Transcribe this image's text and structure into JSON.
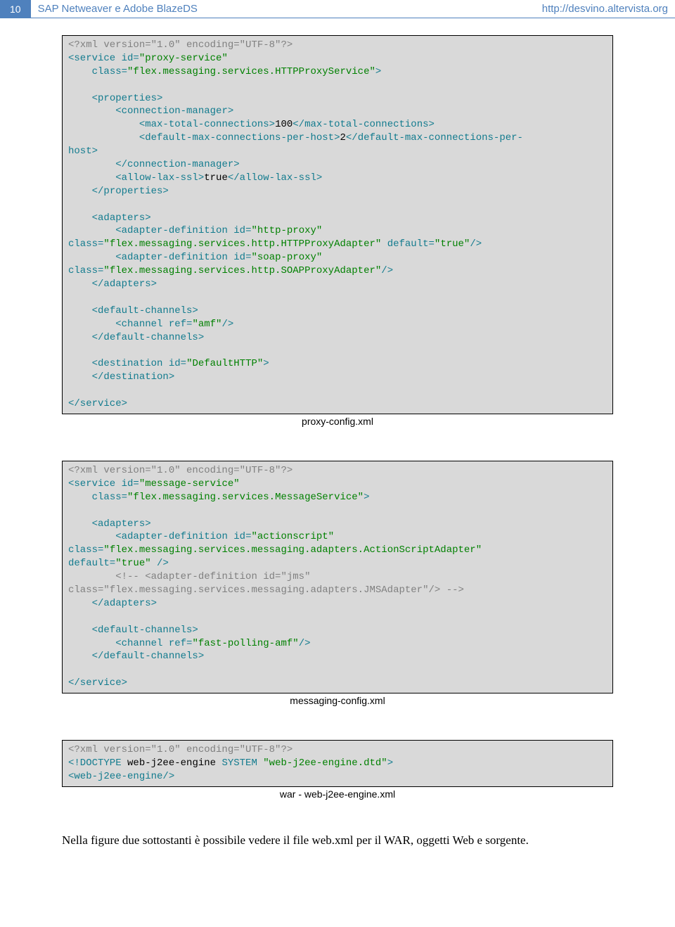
{
  "header": {
    "page_number": "10",
    "title": "SAP Netweaver e Adobe BlazeDS",
    "url": "http://desvino.altervista.org"
  },
  "code_block_1": {
    "caption": "proxy-config.xml",
    "lines": [
      [
        [
          "cmt",
          "<?xml version=\"1.0\" encoding=\"UTF-8\"?>"
        ]
      ],
      [
        [
          "kw",
          "<service"
        ],
        [
          "txtv",
          " "
        ],
        [
          "attr",
          "id="
        ],
        [
          "str",
          "\"proxy-service\""
        ]
      ],
      [
        [
          "txtv",
          "    "
        ],
        [
          "attr",
          "class="
        ],
        [
          "str",
          "\"flex.messaging.services.HTTPProxyService\""
        ],
        [
          "kw",
          ">"
        ]
      ],
      [
        [
          "txtv",
          ""
        ]
      ],
      [
        [
          "txtv",
          "    "
        ],
        [
          "kw",
          "<properties>"
        ]
      ],
      [
        [
          "txtv",
          "        "
        ],
        [
          "kw",
          "<connection-manager>"
        ]
      ],
      [
        [
          "txtv",
          "            "
        ],
        [
          "kw",
          "<max-total-connections>"
        ],
        [
          "txtv",
          "100"
        ],
        [
          "kw",
          "</max-total-connections>"
        ]
      ],
      [
        [
          "txtv",
          "            "
        ],
        [
          "kw",
          "<default-max-connections-per-host>"
        ],
        [
          "txtv",
          "2"
        ],
        [
          "kw",
          "</default-max-connections-per-"
        ]
      ],
      [
        [
          "kw",
          "host>"
        ]
      ],
      [
        [
          "txtv",
          "        "
        ],
        [
          "kw",
          "</connection-manager>"
        ]
      ],
      [
        [
          "txtv",
          "        "
        ],
        [
          "kw",
          "<allow-lax-ssl>"
        ],
        [
          "txtv",
          "true"
        ],
        [
          "kw",
          "</allow-lax-ssl>"
        ]
      ],
      [
        [
          "txtv",
          "    "
        ],
        [
          "kw",
          "</properties>"
        ]
      ],
      [
        [
          "txtv",
          ""
        ]
      ],
      [
        [
          "txtv",
          "    "
        ],
        [
          "kw",
          "<adapters>"
        ]
      ],
      [
        [
          "txtv",
          "        "
        ],
        [
          "kw",
          "<adapter-definition"
        ],
        [
          "txtv",
          " "
        ],
        [
          "attr",
          "id="
        ],
        [
          "str",
          "\"http-proxy\""
        ]
      ],
      [
        [
          "attr",
          "class="
        ],
        [
          "str",
          "\"flex.messaging.services.http.HTTPProxyAdapter\""
        ],
        [
          "txtv",
          " "
        ],
        [
          "attr",
          "default="
        ],
        [
          "str",
          "\"true\""
        ],
        [
          "kw",
          "/>"
        ]
      ],
      [
        [
          "txtv",
          "        "
        ],
        [
          "kw",
          "<adapter-definition"
        ],
        [
          "txtv",
          " "
        ],
        [
          "attr",
          "id="
        ],
        [
          "str",
          "\"soap-proxy\""
        ]
      ],
      [
        [
          "attr",
          "class="
        ],
        [
          "str",
          "\"flex.messaging.services.http.SOAPProxyAdapter\""
        ],
        [
          "kw",
          "/>"
        ]
      ],
      [
        [
          "txtv",
          "    "
        ],
        [
          "kw",
          "</adapters>"
        ]
      ],
      [
        [
          "txtv",
          ""
        ]
      ],
      [
        [
          "txtv",
          "    "
        ],
        [
          "kw",
          "<default-channels>"
        ]
      ],
      [
        [
          "txtv",
          "        "
        ],
        [
          "kw",
          "<channel"
        ],
        [
          "txtv",
          " "
        ],
        [
          "attr",
          "ref="
        ],
        [
          "str",
          "\"amf\""
        ],
        [
          "kw",
          "/>"
        ]
      ],
      [
        [
          "txtv",
          "    "
        ],
        [
          "kw",
          "</default-channels>"
        ]
      ],
      [
        [
          "txtv",
          ""
        ]
      ],
      [
        [
          "txtv",
          "    "
        ],
        [
          "kw",
          "<destination"
        ],
        [
          "txtv",
          " "
        ],
        [
          "attr",
          "id="
        ],
        [
          "str",
          "\"DefaultHTTP\""
        ],
        [
          "kw",
          ">"
        ]
      ],
      [
        [
          "txtv",
          "    "
        ],
        [
          "kw",
          "</destination>"
        ]
      ],
      [
        [
          "txtv",
          ""
        ]
      ],
      [
        [
          "kw",
          "</service>"
        ]
      ]
    ]
  },
  "code_block_2": {
    "caption": "messaging-config.xml",
    "lines": [
      [
        [
          "cmt",
          "<?xml version=\"1.0\" encoding=\"UTF-8\"?>"
        ]
      ],
      [
        [
          "kw",
          "<service"
        ],
        [
          "txtv",
          " "
        ],
        [
          "attr",
          "id="
        ],
        [
          "str",
          "\"message-service\""
        ]
      ],
      [
        [
          "txtv",
          "    "
        ],
        [
          "attr",
          "class="
        ],
        [
          "str",
          "\"flex.messaging.services.MessageService\""
        ],
        [
          "kw",
          ">"
        ]
      ],
      [
        [
          "txtv",
          ""
        ]
      ],
      [
        [
          "txtv",
          "    "
        ],
        [
          "kw",
          "<adapters>"
        ]
      ],
      [
        [
          "txtv",
          "        "
        ],
        [
          "kw",
          "<adapter-definition"
        ],
        [
          "txtv",
          " "
        ],
        [
          "attr",
          "id="
        ],
        [
          "str",
          "\"actionscript\""
        ]
      ],
      [
        [
          "attr",
          "class="
        ],
        [
          "str",
          "\"flex.messaging.services.messaging.adapters.ActionScriptAdapter\""
        ]
      ],
      [
        [
          "attr",
          "default="
        ],
        [
          "str",
          "\"true\""
        ],
        [
          "txtv",
          " "
        ],
        [
          "kw",
          "/>"
        ]
      ],
      [
        [
          "txtv",
          "        "
        ],
        [
          "cmt",
          "<!-- <adapter-definition id=\"jms\""
        ]
      ],
      [
        [
          "cmt",
          "class=\"flex.messaging.services.messaging.adapters.JMSAdapter\"/> -->"
        ]
      ],
      [
        [
          "txtv",
          "    "
        ],
        [
          "kw",
          "</adapters>"
        ]
      ],
      [
        [
          "txtv",
          ""
        ]
      ],
      [
        [
          "txtv",
          "    "
        ],
        [
          "kw",
          "<default-channels>"
        ]
      ],
      [
        [
          "txtv",
          "        "
        ],
        [
          "kw",
          "<channel"
        ],
        [
          "txtv",
          " "
        ],
        [
          "attr",
          "ref="
        ],
        [
          "str",
          "\"fast-polling-amf\""
        ],
        [
          "kw",
          "/>"
        ]
      ],
      [
        [
          "txtv",
          "    "
        ],
        [
          "kw",
          "</default-channels>"
        ]
      ],
      [
        [
          "txtv",
          ""
        ]
      ],
      [
        [
          "kw",
          "</service>"
        ]
      ]
    ]
  },
  "code_block_3": {
    "caption": "war - web-j2ee-engine.xml",
    "lines": [
      [
        [
          "cmt",
          "<?xml version=\"1.0\" encoding=\"UTF-8\"?>"
        ]
      ],
      [
        [
          "kw",
          "<!DOCTYPE"
        ],
        [
          "txtv",
          " web-j2ee-engine "
        ],
        [
          "kw",
          "SYSTEM"
        ],
        [
          "txtv",
          " "
        ],
        [
          "str",
          "\"web-j2ee-engine.dtd\""
        ],
        [
          "kw",
          ">"
        ]
      ],
      [
        [
          "kw",
          "<web-j2ee-engine/>"
        ]
      ]
    ]
  },
  "body_paragraph": "Nella figure due sottostanti è possibile vedere il file web.xml per il WAR, oggetti Web e sorgente."
}
